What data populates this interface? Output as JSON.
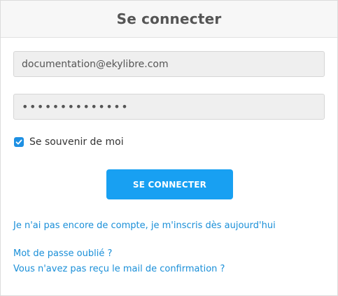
{
  "header": {
    "title": "Se connecter"
  },
  "form": {
    "email_value": "documentation@ekylibre.com",
    "password_value": "••••••••••••••",
    "remember_label": "Se souvenir de moi",
    "remember_checked": true,
    "submit_label": "SE CONNECTER"
  },
  "links": {
    "register": "Je n'ai pas encore de compte, je m'inscris dès aujourd'hui",
    "forgot_password": "Mot de passe oublié ?",
    "confirmation_mail": "Vous n'avez pas reçu le mail de confirmation ?"
  },
  "colors": {
    "accent": "#18a0f2",
    "link": "#1a8fd8",
    "checkbox": "#1e90e3",
    "header_bg": "#f7f7f7",
    "field_bg": "#efefef"
  },
  "icons": {
    "checkbox": "check-icon"
  }
}
